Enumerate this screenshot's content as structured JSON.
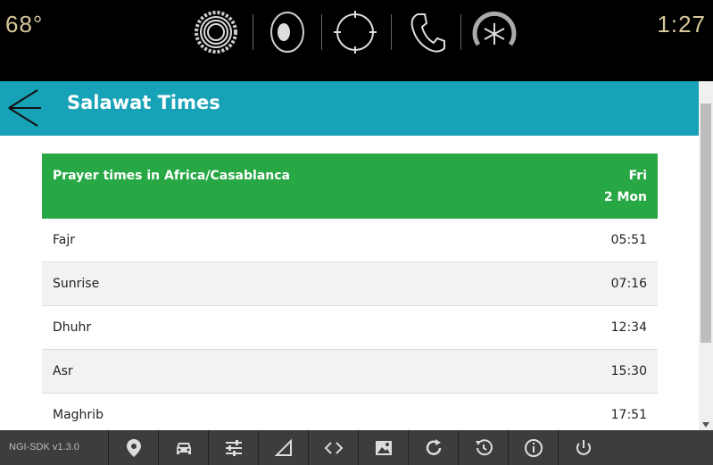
{
  "statusbar": {
    "temperature": "68°",
    "time": "1:27",
    "icons": [
      "settings-gear-icon",
      "speaker-icon",
      "navigation-compass-icon",
      "phone-icon",
      "climate-fan-icon"
    ]
  },
  "app": {
    "title": "Salawat Times"
  },
  "table": {
    "header_title": "Prayer times in Africa/Casablanca",
    "header_day": "Fri",
    "header_date": "2 Mon",
    "rows": [
      {
        "name": "Fajr",
        "time": "05:51"
      },
      {
        "name": "Sunrise",
        "time": "07:16"
      },
      {
        "name": "Dhuhr",
        "time": "12:34"
      },
      {
        "name": "Asr",
        "time": "15:30"
      },
      {
        "name": "Maghrib",
        "time": "17:51"
      }
    ]
  },
  "bottombar": {
    "sdk_version": "NGI-SDK v1.3.0",
    "icons": [
      "location-pin-icon",
      "car-icon",
      "sliders-icon",
      "signal-icon",
      "code-icon",
      "image-icon",
      "refresh-icon",
      "history-icon",
      "info-icon",
      "power-icon"
    ]
  },
  "colors": {
    "appbar": "#17a2b8",
    "table_header": "#28a745",
    "status_text": "#d8c79a",
    "bottombar": "#3d3d3d"
  }
}
